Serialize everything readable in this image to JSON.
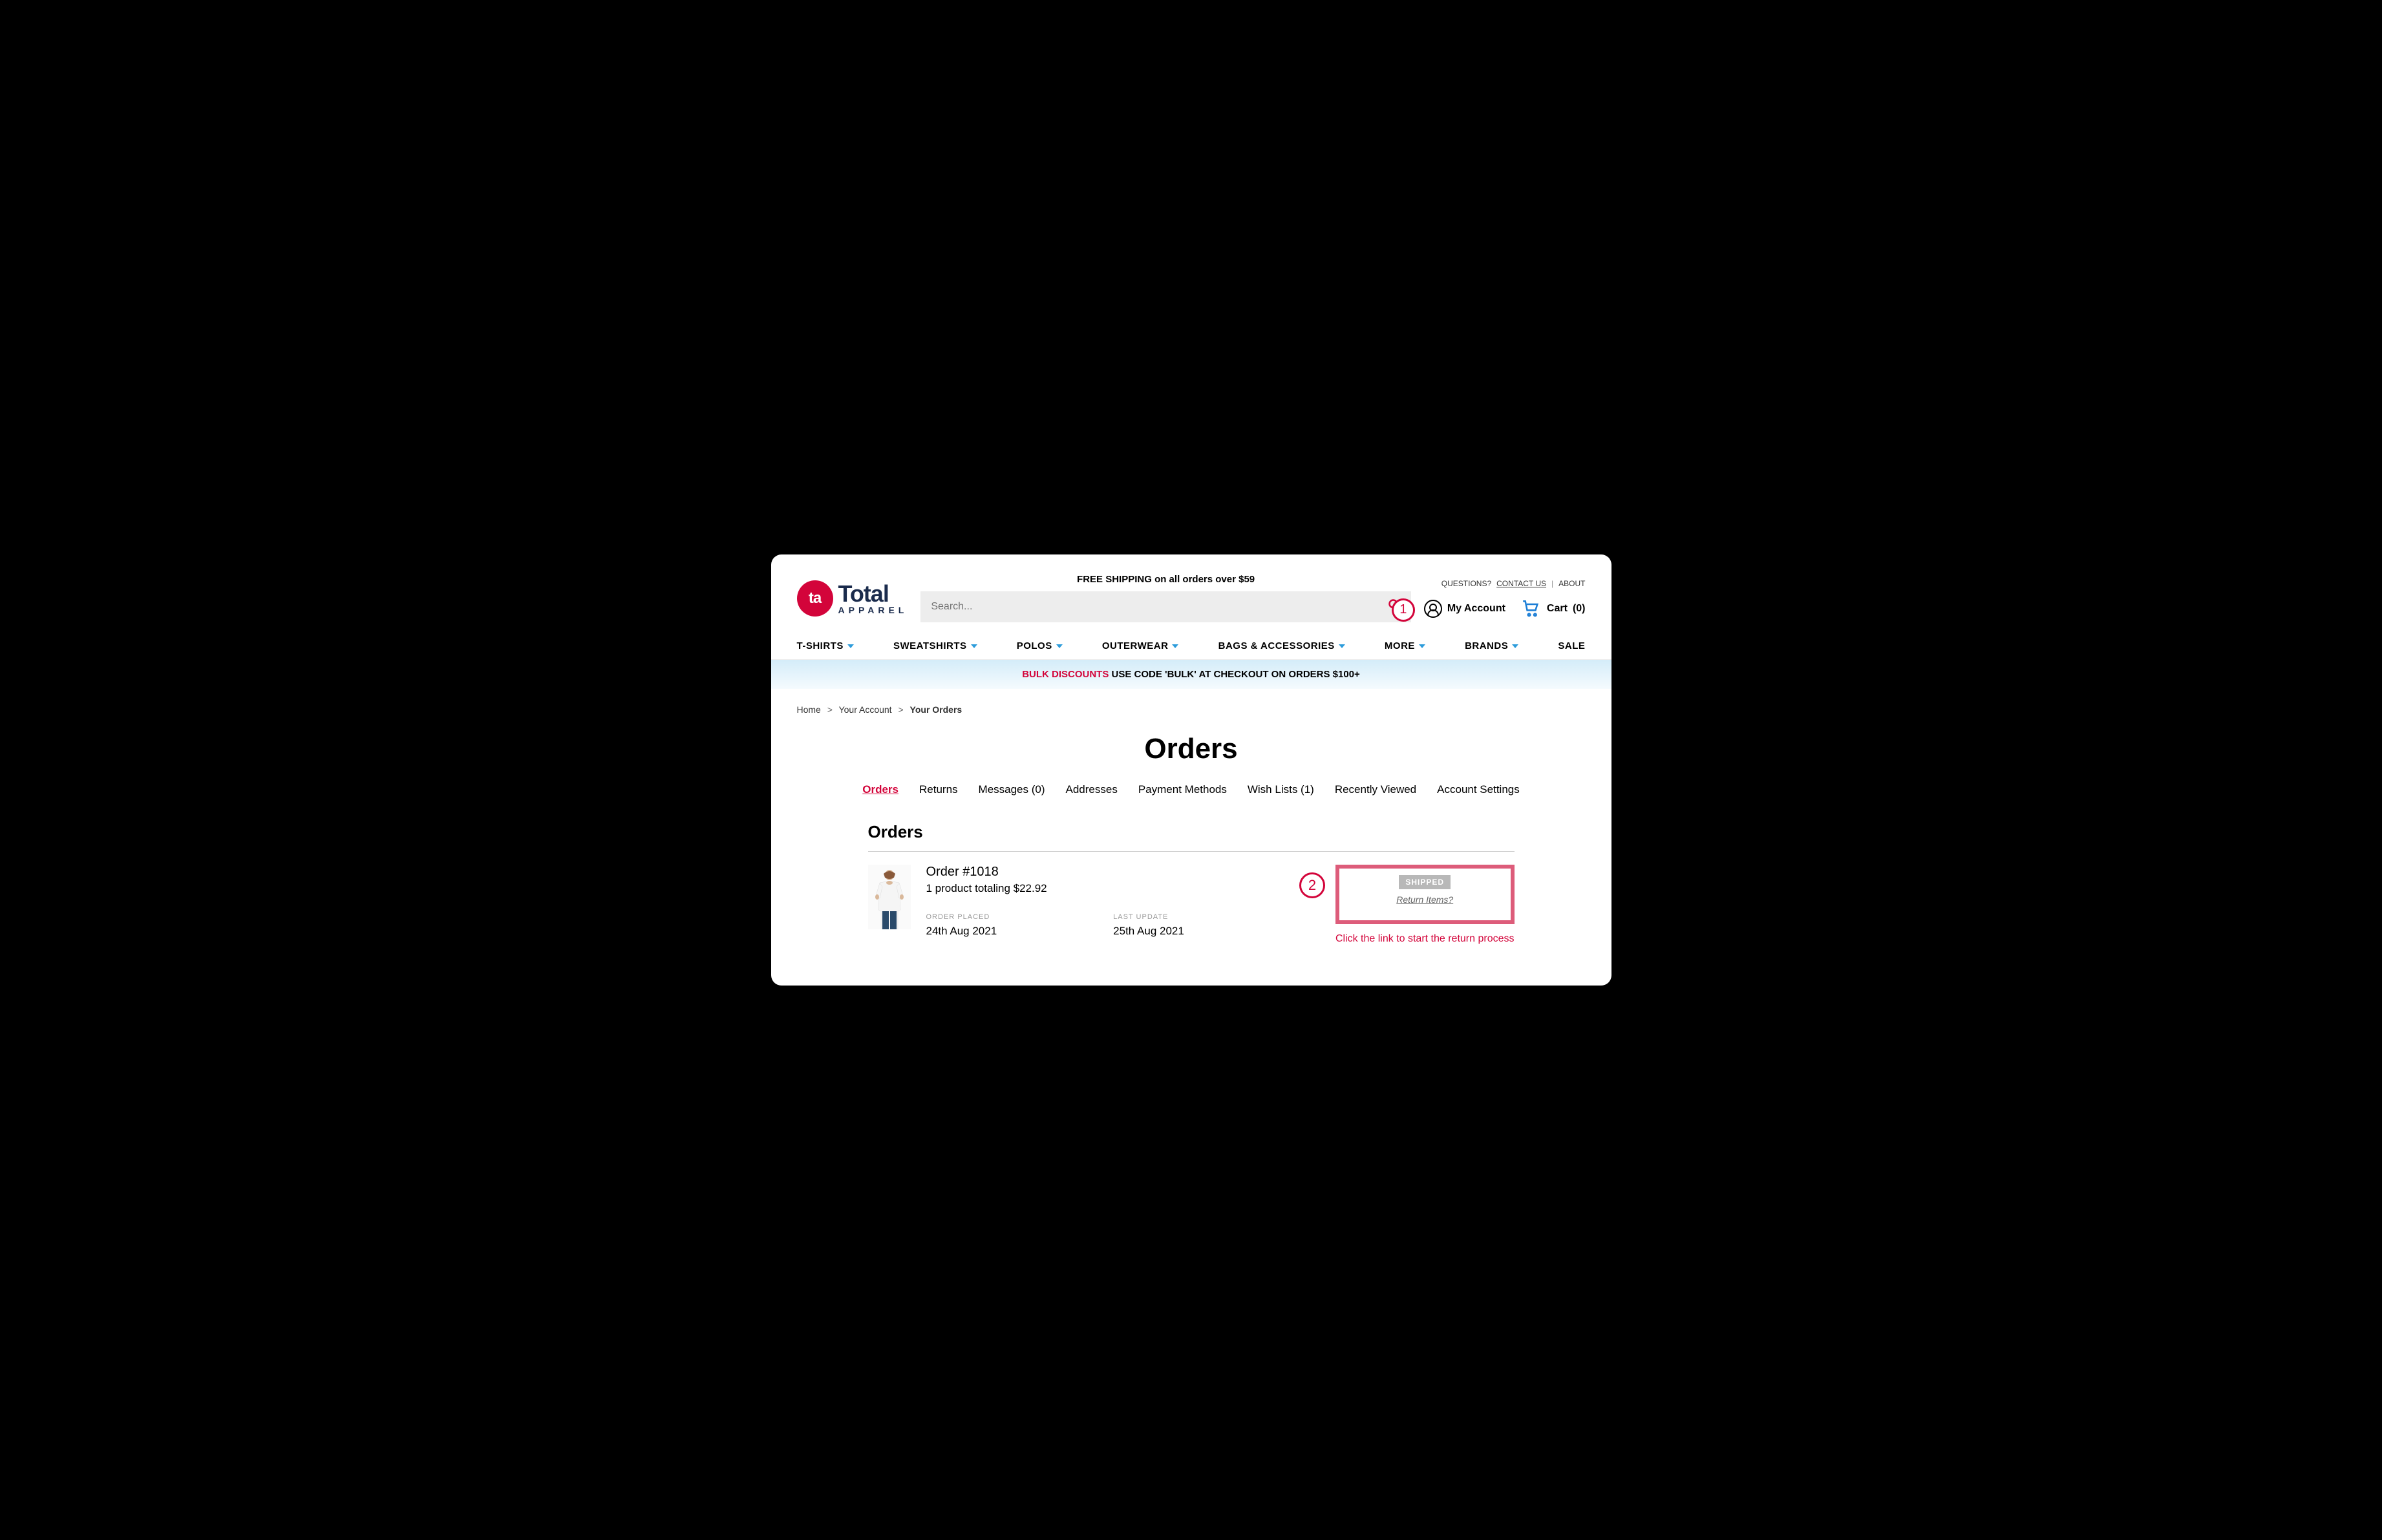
{
  "header": {
    "logo_abbrev": "ta",
    "logo_total": "Total",
    "logo_apparel": "APPAREL",
    "free_shipping": "FREE SHIPPING on all orders over $59",
    "search_placeholder": "Search...",
    "questions": "QUESTIONS?",
    "contact": "CONTACT US",
    "about": "ABOUT",
    "my_account": "My Account",
    "cart_label": "Cart",
    "cart_count": "(0)"
  },
  "nav": {
    "tshirts": "T-SHIRTS",
    "sweatshirts": "SWEATSHIRTS",
    "polos": "POLOS",
    "outerwear": "OUTERWEAR",
    "bags": "BAGS & ACCESSORIES",
    "more": "MORE",
    "brands": "BRANDS",
    "sale": "SALE"
  },
  "promo": {
    "bulk": "BULK DISCOUNTS",
    "rest": " USE CODE 'BULK' AT CHECKOUT ON ORDERS $100+"
  },
  "breadcrumb": {
    "home": "Home",
    "account": "Your Account",
    "current": "Your Orders"
  },
  "page": {
    "title": "Orders"
  },
  "tabs": {
    "orders": "Orders",
    "returns": "Returns",
    "messages": "Messages (0)",
    "addresses": "Addresses",
    "payment": "Payment Methods",
    "wishlists": "Wish Lists (1)",
    "recently": "Recently Viewed",
    "settings": "Account Settings"
  },
  "orders": {
    "heading": "Orders",
    "item": {
      "number": "Order #1018",
      "summary": "1 product totaling $22.92",
      "placed_label": "ORDER PLACED",
      "placed_value": "24th Aug 2021",
      "update_label": "LAST UPDATE",
      "update_value": "25th Aug 2021",
      "status": "SHIPPED",
      "return_link": "Return Items?"
    }
  },
  "annotations": {
    "one": "1",
    "two": "2",
    "caption": "Click the link to start the return process"
  }
}
